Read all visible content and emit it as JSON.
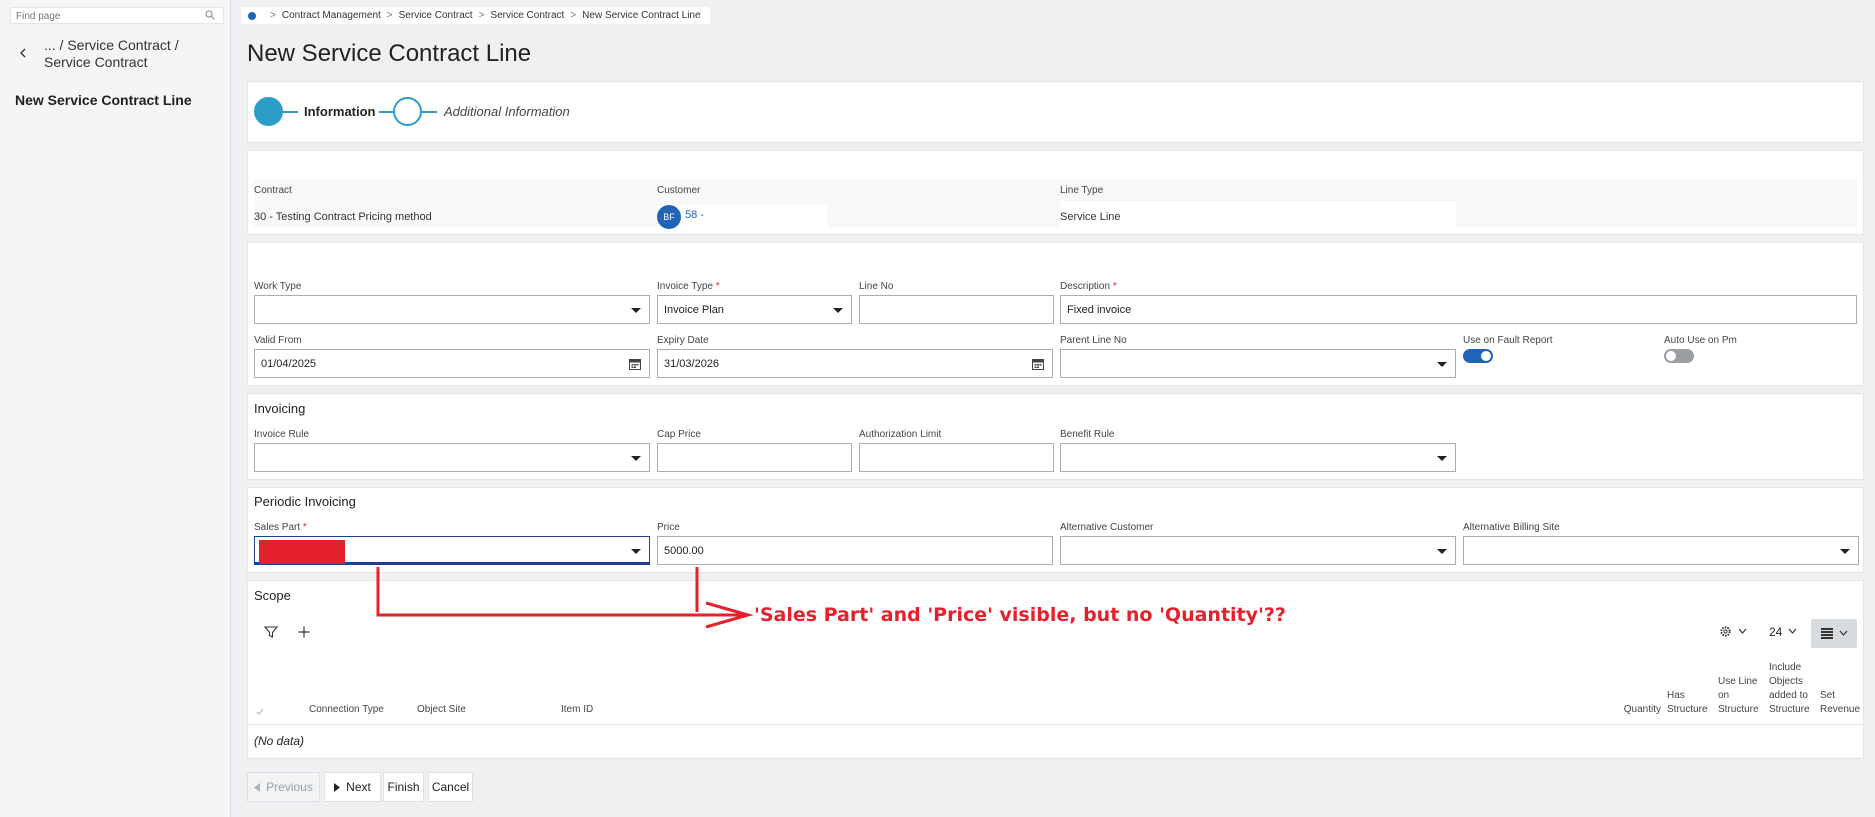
{
  "sidebar": {
    "find_placeholder": "Find page",
    "breadcrumb": "... / Service Contract / Service Contract",
    "title": "New Service Contract Line"
  },
  "breadcrumb": [
    "Contract Management",
    "Service Contract",
    "Service Contract",
    "New Service Contract Line"
  ],
  "page_title": "New Service Contract Line",
  "stepper": {
    "step1": "Information",
    "step2": "Additional Information"
  },
  "header": {
    "contract_label": "Contract",
    "contract_value": "30 - Testing Contract Pricing method",
    "customer_label": "Customer",
    "customer_avatar": "BF",
    "customer_value": "58 -",
    "line_type_label": "Line Type",
    "line_type_value": "Service Line"
  },
  "general": {
    "work_type_label": "Work Type",
    "work_type_value": "",
    "invoice_type_label": "Invoice Type",
    "invoice_type_value": "Invoice Plan",
    "line_no_label": "Line No",
    "line_no_value": "",
    "description_label": "Description",
    "description_value": "Fixed invoice",
    "valid_from_label": "Valid From",
    "valid_from_value": "01/04/2025",
    "expiry_label": "Expiry Date",
    "expiry_value": "31/03/2026",
    "parent_line_label": "Parent Line No",
    "parent_line_value": "",
    "fault_report_label": "Use on Fault Report",
    "fault_report_on": true,
    "auto_pm_label": "Auto Use on Pm",
    "auto_pm_on": false
  },
  "invoicing": {
    "title": "Invoicing",
    "rule_label": "Invoice Rule",
    "cap_label": "Cap Price",
    "auth_label": "Authorization Limit",
    "benefit_label": "Benefit Rule"
  },
  "periodic": {
    "title": "Periodic Invoicing",
    "sales_part_label": "Sales Part",
    "price_label": "Price",
    "price_value": "5000.00",
    "alt_customer_label": "Alternative Customer",
    "alt_billing_label": "Alternative Billing Site"
  },
  "scope": {
    "title": "Scope",
    "page_size": "24",
    "columns_left": [
      "Connection Type",
      "Object Site",
      "Item ID"
    ],
    "columns_right": [
      "Quantity",
      "Has Structure",
      "Use Line on Structure",
      "Include Objects added to Structure",
      "Set Revenue"
    ],
    "no_data": "(No data)"
  },
  "footer": {
    "previous": "Previous",
    "next": "Next",
    "finish": "Finish",
    "cancel": "Cancel"
  },
  "annotation": "'Sales Part' and 'Price' visible, but no 'Quantity'??",
  "colors": {
    "accent": "#2c9ec6",
    "toggle_on": "#1f64b6",
    "required": "#d32f2f",
    "annotation": "#e5212b"
  }
}
